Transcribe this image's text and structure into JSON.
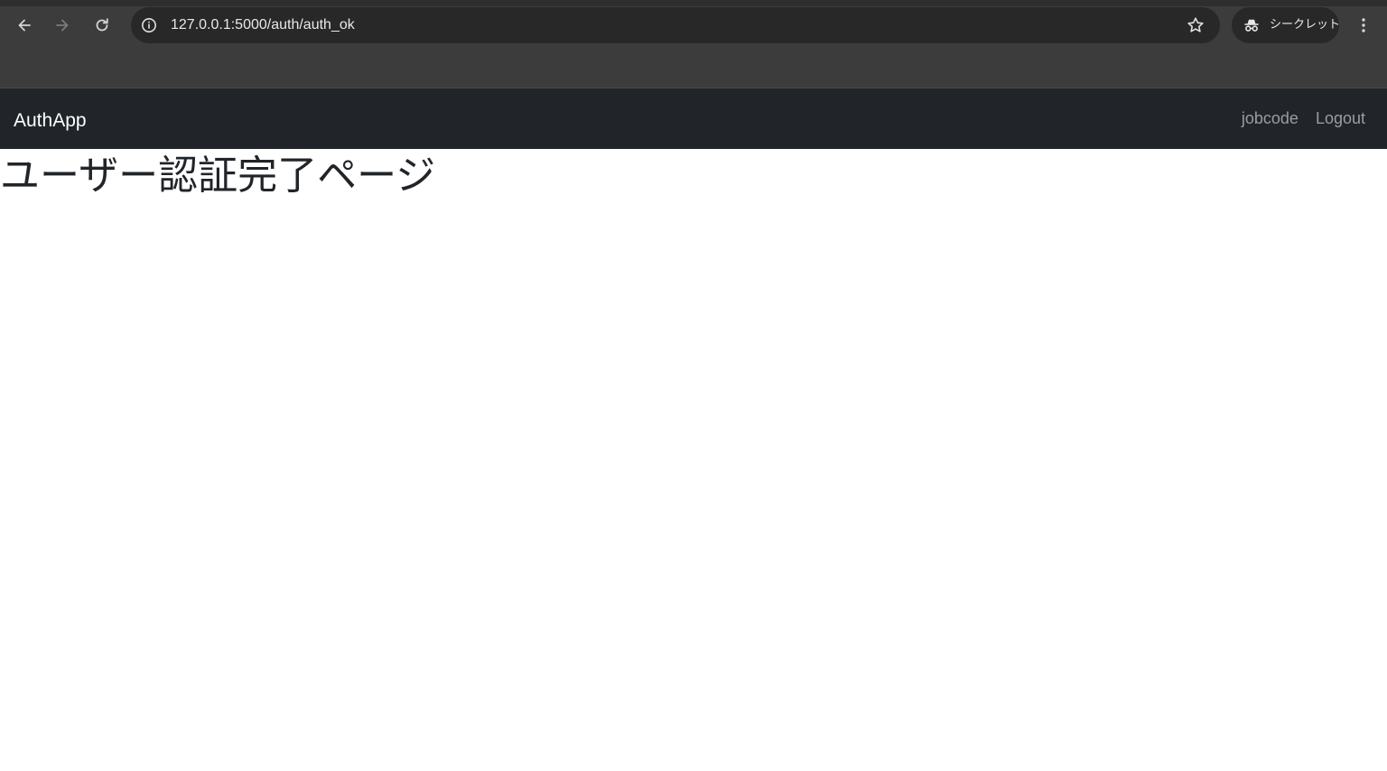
{
  "browser": {
    "url": "127.0.0.1:5000/auth/auth_ok",
    "incognito_label": "シークレット",
    "icons": {
      "back": "arrow-left-icon",
      "forward": "arrow-right-icon",
      "reload": "reload-icon",
      "info": "info-icon",
      "bookmark": "star-icon",
      "incognito": "incognito-icon",
      "menu": "kebab-menu-icon"
    }
  },
  "navbar": {
    "brand": "AuthApp",
    "links": [
      {
        "label": "jobcode"
      },
      {
        "label": "Logout"
      }
    ]
  },
  "main": {
    "title": "ユーザー認証完了ページ"
  },
  "colors": {
    "chrome_bg": "#3c3c3c",
    "omnibox_bg": "#282828",
    "navbar_bg": "#212529",
    "nav_link": "#9a9da1",
    "text": "#212529"
  }
}
